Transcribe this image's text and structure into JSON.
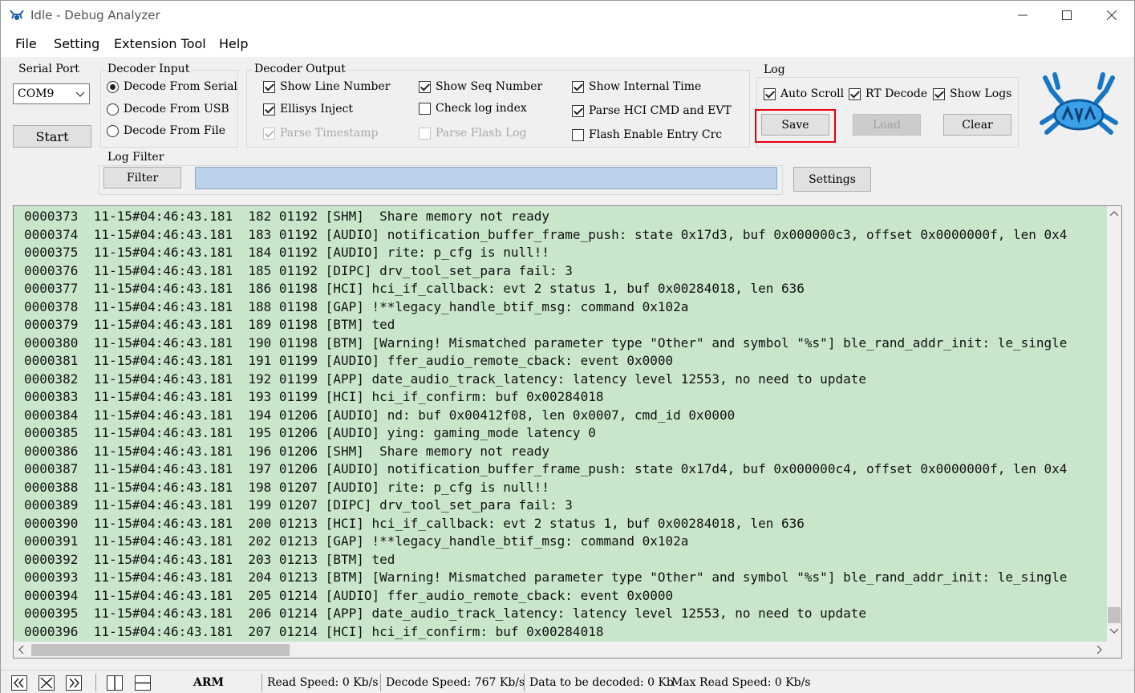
{
  "window": {
    "title": "Idle - Debug Analyzer"
  },
  "menu": [
    "File",
    "Setting",
    "Extension Tool",
    "Help"
  ],
  "serial_port": {
    "label": "Serial Port",
    "value": "COM9",
    "start_label": "Start"
  },
  "decoder_input": {
    "label": "Decoder Input",
    "options": [
      "Decode From Serial",
      "Decode From USB",
      "Decode From File"
    ],
    "selected": 0
  },
  "decoder_output": {
    "label": "Decoder Output",
    "show_line_number": "Show Line Number",
    "show_seq_number": "Show Seq Number",
    "show_internal_time": "Show Internal Time",
    "ellisys_inject": "Ellisys Inject",
    "check_log_index": "Check log index",
    "parse_hci": "Parse HCI CMD and EVT",
    "parse_timestamp": "Parse Timestamp",
    "parse_flash_log": "Parse Flash Log",
    "flash_enable_entry_crc": "Flash Enable Entry Crc"
  },
  "log": {
    "label": "Log",
    "auto_scroll": "Auto Scroll",
    "rt_decode": "RT Decode",
    "show_logs": "Show Logs",
    "save_label": "Save",
    "load_label": "Load",
    "clear_label": "Clear"
  },
  "log_filter": {
    "label": "Log Filter",
    "filter_button": "Filter",
    "value": ""
  },
  "settings_label": "Settings",
  "log_lines": [
    "0000373  11-15#04:46:43.181  182 01192 [SHM]  Share memory not ready",
    "0000374  11-15#04:46:43.181  183 01192 [AUDIO] notification_buffer_frame_push: state 0x17d3, buf 0x000000c3, offset 0x0000000f, len 0x4",
    "0000375  11-15#04:46:43.181  184 01192 [AUDIO] rite: p_cfg is null!!",
    "0000376  11-15#04:46:43.181  185 01192 [DIPC] drv_tool_set_para fail: 3",
    "0000377  11-15#04:46:43.181  186 01198 [HCI] hci_if_callback: evt 2 status 1, buf 0x00284018, len 636",
    "0000378  11-15#04:46:43.181  188 01198 [GAP] !**legacy_handle_btif_msg: command 0x102a",
    "0000379  11-15#04:46:43.181  189 01198 [BTM] ted",
    "0000380  11-15#04:46:43.181  190 01198 [BTM] [Warning! Mismatched parameter type \"Other\" and symbol \"%s\"] ble_rand_addr_init: le_single",
    "0000381  11-15#04:46:43.181  191 01199 [AUDIO] ffer_audio_remote_cback: event 0x0000",
    "0000382  11-15#04:46:43.181  192 01199 [APP] date_audio_track_latency: latency level 12553, no need to update",
    "0000383  11-15#04:46:43.181  193 01199 [HCI] hci_if_confirm: buf 0x00284018",
    "0000384  11-15#04:46:43.181  194 01206 [AUDIO] nd: buf 0x00412f08, len 0x0007, cmd_id 0x0000",
    "0000385  11-15#04:46:43.181  195 01206 [AUDIO] ying: gaming_mode latency 0",
    "0000386  11-15#04:46:43.181  196 01206 [SHM]  Share memory not ready",
    "0000387  11-15#04:46:43.181  197 01206 [AUDIO] notification_buffer_frame_push: state 0x17d4, buf 0x000000c4, offset 0x0000000f, len 0x4",
    "0000388  11-15#04:46:43.181  198 01207 [AUDIO] rite: p_cfg is null!!",
    "0000389  11-15#04:46:43.181  199 01207 [DIPC] drv_tool_set_para fail: 3",
    "0000390  11-15#04:46:43.181  200 01213 [HCI] hci_if_callback: evt 2 status 1, buf 0x00284018, len 636",
    "0000391  11-15#04:46:43.181  202 01213 [GAP] !**legacy_handle_btif_msg: command 0x102a",
    "0000392  11-15#04:46:43.181  203 01213 [BTM] ted",
    "0000393  11-15#04:46:43.181  204 01213 [BTM] [Warning! Mismatched parameter type \"Other\" and symbol \"%s\"] ble_rand_addr_init: le_single",
    "0000394  11-15#04:46:43.181  205 01214 [AUDIO] ffer_audio_remote_cback: event 0x0000",
    "0000395  11-15#04:46:43.181  206 01214 [APP] date_audio_track_latency: latency level 12553, no need to update",
    "0000396  11-15#04:46:43.181  207 01214 [HCI] hci_if_confirm: buf 0x00284018"
  ],
  "status": {
    "arch": "ARM",
    "read_speed": "Read Speed:  0 Kb/s",
    "decode_speed": "Decode Speed:  767 Kb/s",
    "data_to_decode": "Data to be decoded:  0 Kb",
    "max_read_speed": "Max Read Speed:  0 Kb/s"
  },
  "icons": [
    "app-logo-icon",
    "minimize-icon",
    "maximize-icon",
    "close-icon",
    "chevron-down-icon",
    "realtek-crab-logo",
    "collapse-left-icon",
    "collapse-center-icon",
    "collapse-right-icon",
    "split-vertical-icon",
    "split-horizontal-icon"
  ]
}
